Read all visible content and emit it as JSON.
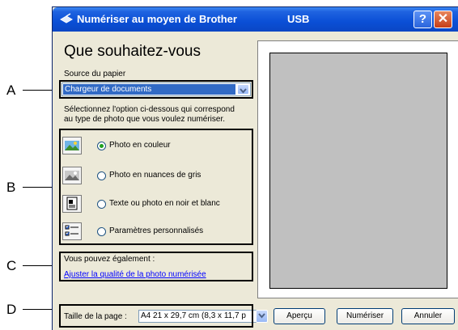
{
  "window": {
    "title": "Numériser au moyen de Brother",
    "connection": "USB"
  },
  "callouts": {
    "a": "A",
    "b": "B",
    "c": "C",
    "d": "D"
  },
  "heading": "Que souhaitez-vous",
  "paper_source": {
    "label": "Source du papier",
    "value": "Chargeur de documents"
  },
  "instruction": {
    "line1": "Sélectionnez l'option ci-dessous qui correspond",
    "line2": "au type de photo que vous voulez numériser."
  },
  "scan_types": [
    {
      "label": "Photo en couleur",
      "selected": true,
      "icon": "color-photo-icon"
    },
    {
      "label": "Photo en nuances de gris",
      "selected": false,
      "icon": "grayscale-photo-icon"
    },
    {
      "label": "Texte ou photo en noir et blanc",
      "selected": false,
      "icon": "bw-text-icon"
    },
    {
      "label": "Paramètres personnalisés",
      "selected": false,
      "icon": "custom-settings-icon"
    }
  ],
  "also": {
    "label": "Vous pouvez également :",
    "link": "Ajuster la qualité de la photo numérisée"
  },
  "page_size": {
    "label": "Taille de la page :",
    "value": "A4 21 x 29,7 cm (8,3 x 11,7 p"
  },
  "buttons": {
    "preview": "Aperçu",
    "scan": "Numériser",
    "cancel": "Annuler"
  },
  "colors": {
    "title_bar": "#0a4fd6",
    "selection": "#316ac5",
    "link": "#0000ff",
    "preview_bg": "#c0c0c0"
  }
}
